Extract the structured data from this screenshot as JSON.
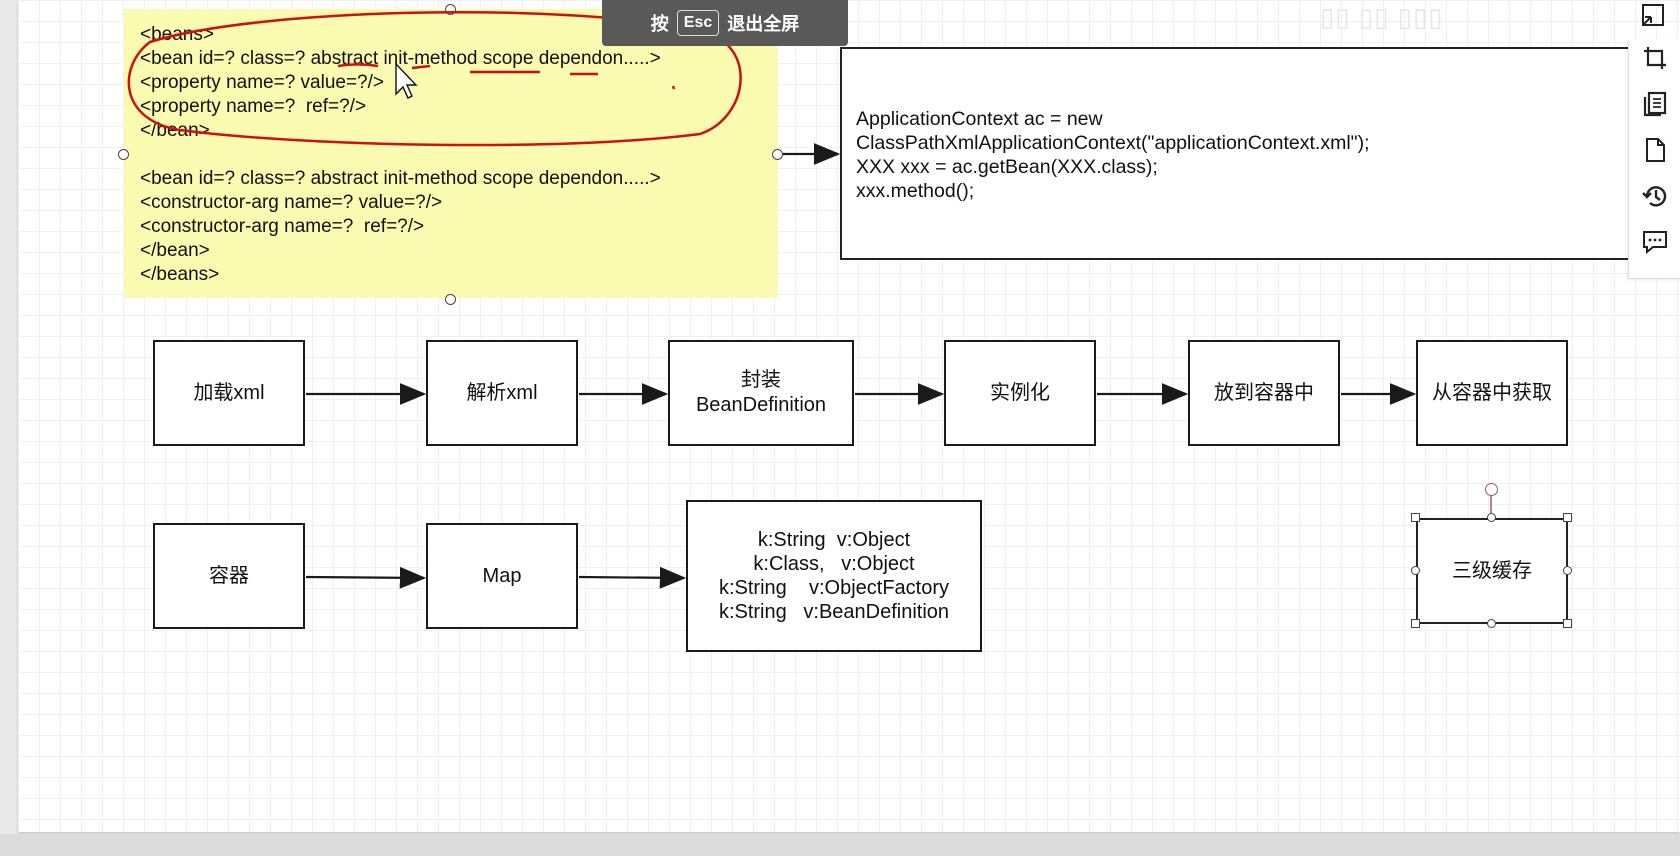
{
  "toolbar": {
    "press_label": "按",
    "esc_key": "Esc",
    "exit_label": "退出全屏"
  },
  "xml_note": {
    "lines": [
      "<beans>",
      "<bean id=? class=? abstract init-method scope dependon.....>",
      "<property name=? value=?/>",
      "<property name=?  ref=?/>",
      "</bean>",
      "",
      "<bean id=? class=? abstract init-method scope dependon.....>",
      "<constructor-arg name=? value=?/>",
      "<constructor-arg name=?  ref=?/>",
      "</bean>",
      "</beans>"
    ]
  },
  "code_box": {
    "lines": [
      "ApplicationContext ac = new",
      "ClassPathXmlApplicationContext(\"applicationContext.xml\");",
      "XXX xxx = ac.getBean(XXX.class);",
      "xxx.method();"
    ]
  },
  "flow": {
    "steps": [
      {
        "line1": "",
        "line2": "加载xml"
      },
      {
        "line1": "",
        "line2": "解析xml"
      },
      {
        "line1": "封装",
        "line2": "BeanDefinition"
      },
      {
        "line1": "",
        "line2": "实例化"
      },
      {
        "line1": "",
        "line2": "放到容器中"
      },
      {
        "line1": "",
        "line2": "从容器中获取"
      }
    ]
  },
  "container_flow": {
    "container": "容器",
    "map": "Map",
    "map_values": [
      "k:String  v:Object",
      "k:Class,   v:Object",
      "k:String    v:ObjectFactory",
      "k:String   v:BeanDefinition"
    ]
  },
  "cache_box": {
    "label": "三级缓存"
  },
  "side_toolbar": {
    "icons": [
      "crop-icon",
      "page-copy-icon",
      "blank-page-icon",
      "history-icon",
      "comment-icon"
    ]
  },
  "colors": {
    "note_fill": "#fafab0",
    "annotation_red": "#cc1111",
    "toolbar_bg": "#595959"
  }
}
